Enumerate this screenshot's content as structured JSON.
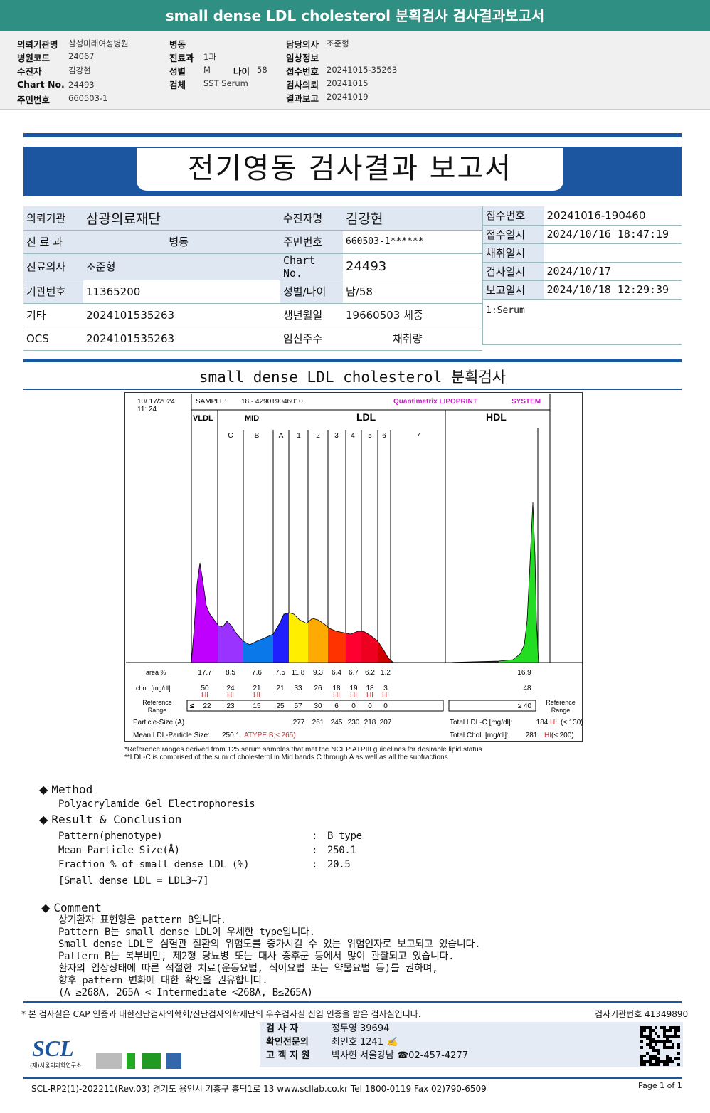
{
  "top_title": "small dense LDL cholesterol 분획검사 검사결과보고서",
  "header": {
    "col1": [
      {
        "k": "의뢰기관명",
        "v": "삼성미래여성병원"
      },
      {
        "k": "병원코드",
        "v": "24067"
      },
      {
        "k": "수진자",
        "v": "김강현"
      },
      {
        "k": "Chart No.",
        "v": "24493"
      },
      {
        "k": "주민번호",
        "v": "660503-1"
      }
    ],
    "col2": [
      {
        "k": "병동",
        "v": ""
      },
      {
        "k": "진료과",
        "v": "1과"
      },
      {
        "k": "성별",
        "v": "M"
      },
      {
        "k": "검체",
        "v": "SST Serum"
      }
    ],
    "age_label": "나이",
    "age": "58",
    "col3": [
      {
        "k": "담당의사",
        "v": "조준형"
      },
      {
        "k": "임상정보",
        "v": ""
      },
      {
        "k": "접수번호",
        "v": "20241015-35263"
      },
      {
        "k": "검사의뢰",
        "v": "20241015"
      },
      {
        "k": "결과보고",
        "v": "20241019"
      }
    ]
  },
  "report_title": "전기영동 검사결과 보고서",
  "info": {
    "inst_label": "의뢰기관",
    "inst": "삼광의료재단",
    "patient_label": "수진자명",
    "patient": "김강현",
    "receipt_no_label": "접수번호",
    "receipt_no": "20241016-190460",
    "dept_label": "진 료 과",
    "ward_label": "병동",
    "id_label": "주민번호",
    "id": "660503-1******",
    "receipt_date_label": "접수일시",
    "receipt_date": "2024/10/16 18:47:19",
    "collect_label": "채취일시",
    "collect": "",
    "doctor_label": "진료의사",
    "doctor": "조준형",
    "chart_label": "Chart No.",
    "chart": "24493",
    "test_date_label": "검사일시",
    "test_date": "2024/10/17",
    "code_label": "기관번호",
    "code": "11365200",
    "sexage_label": "성별/나이",
    "sexage": "남/58",
    "report_date_label": "보고일시",
    "report_date": "2024/10/18 12:29:39",
    "etc_label": "기타",
    "etc": "2024101535263",
    "birth_label": "생년월일",
    "birth": "19660503",
    "weight_label": "체중",
    "specimen": "1:Serum",
    "ocs_label": "OCS",
    "ocs": "2024101535263",
    "preg_label": "임신주수",
    "volume_label": "채취량"
  },
  "section_title": "small dense LDL cholesterol 분획검사",
  "chart": {
    "date": "10/ 17/2024",
    "time": "11: 24",
    "sample_label": "SAMPLE:",
    "sample": "18 - 429019046010",
    "brand": "Quantimetrix LIPOPRINT",
    "brand2": "SYSTEM",
    "groups": [
      "VLDL",
      "MID",
      "LDL",
      "HDL"
    ],
    "bands": [
      "C",
      "B",
      "A",
      "1",
      "2",
      "3",
      "4",
      "5",
      "6",
      "7"
    ],
    "area_label": "area %",
    "area": [
      "17.7",
      "8.5",
      "7.6",
      "7.5",
      "11.8",
      "9.3",
      "6.4",
      "6.7",
      "6.2",
      "1.2"
    ],
    "area_hdl": "16.9",
    "chol_label": "chol. [mg/dl]",
    "chol": [
      "50",
      "24",
      "21",
      "21",
      "33",
      "26",
      "18",
      "19",
      "18",
      "3"
    ],
    "chol_hdl": "48",
    "chol_flags": [
      "HI",
      "HI",
      "HI",
      "",
      "",
      "",
      "HI",
      "HI",
      "HI",
      "HI"
    ],
    "ref_label": "Reference Range",
    "ref_le": "≤",
    "ref": [
      "22",
      "23",
      "15",
      "25",
      "57",
      "30",
      "6",
      "0",
      "0",
      "0"
    ],
    "ref_hdl": "≥  40",
    "size_label": "Particle-Size (A)",
    "sizes": [
      "277",
      "261",
      "245",
      "230",
      "218",
      "207"
    ],
    "mean_label": "Mean LDL-Particle Size:",
    "mean": "250.1",
    "mean_type": "ATYPE B;≤ 265)",
    "total_ldl_label": "Total LDL-C [mg/dl]:",
    "total_ldl": "184",
    "total_ldl_flag": "HI",
    "total_ldl_ref": "(≤ 130)",
    "total_chol_label": "Total Chol. [mg/dl]:",
    "total_chol": "281",
    "total_chol_flag": "HI",
    "total_chol_ref": "(≤ 200)",
    "note1": "*Reference ranges derived from 125 serum samples that met the NCEP ATPIII guidelines for desirable lipid status",
    "note2": "**LDL-C is comprised of the sum of cholesterol in Mid bands C through A as well as all the subfractions",
    "colors": {
      "vldl": "#c000ff",
      "c": "#9a33ff",
      "b": "#0a78e8",
      "a": "#2020ff",
      "l1": "#ffee00",
      "l2": "#ffaa00",
      "l3": "#ff3300",
      "l4": "#ff0030",
      "l5": "#ee0020",
      "l6": "#d00000",
      "hdl": "#22dd22"
    }
  },
  "method": {
    "title": "Method",
    "text": "Polyacrylamide Gel Electrophoresis"
  },
  "result": {
    "title": "Result & Conclusion",
    "rows": [
      {
        "k": "Pattern(phenotype)",
        "v": "B type"
      },
      {
        "k": "Mean Particle Size(Å)",
        "v": "250.1"
      },
      {
        "k": "Fraction % of small dense LDL (%)",
        "v": "20.5"
      }
    ],
    "note": "[Small dense LDL = LDL3~7]"
  },
  "comment": {
    "title": "Comment",
    "lines": [
      "상기환자 표현형은 pattern B입니다.",
      "Pattern B는 small dense LDL이 우세한 type입니다.",
      "Small dense LDL은 심혈관 질환의 위험도를 증가시킬 수 있는 위험인자로 보고되고 있습니다.",
      "Pattern B는 복부비만, 제2형 당뇨병 또는 대사 증후군 등에서 많이 관찰되고 있습니다.",
      "환자의 임상상태에 따른 적절한 치료(운동요법, 식이요법 또는 약물요법 등)를 권하며,",
      "향후 pattern 변화에 대한 확인을 권유합니다.",
      "(A ≥268A, 265A < Intermediate <268A, B≤265A)"
    ]
  },
  "footer": {
    "cert": "* 본 검사실은 CAP 인증과 대한진단검사의학회/진단검사의학재단의 우수검사실 신임 인증을 받은 검사실입니다.",
    "lab_no": "검사기관번호 41349890",
    "tester_label": "검 사 자",
    "tester": "정두영 39694",
    "confirm_label": "확인전문의",
    "confirm": "최인호 1241",
    "support_label": "고 객 지 원",
    "support": "박사현 서울강남 ☎02-457-4277",
    "logo": "SCL",
    "logo_sub": "(재)서울의과학연구소",
    "address": "SCL-RP2(1)-202211(Rev.03) 경기도 용인시 기흥구 흥덕1로 13 www.scllab.co.kr  Tel 1800-0119   Fax 02)790-6509",
    "page": "Page 1 of 1"
  }
}
